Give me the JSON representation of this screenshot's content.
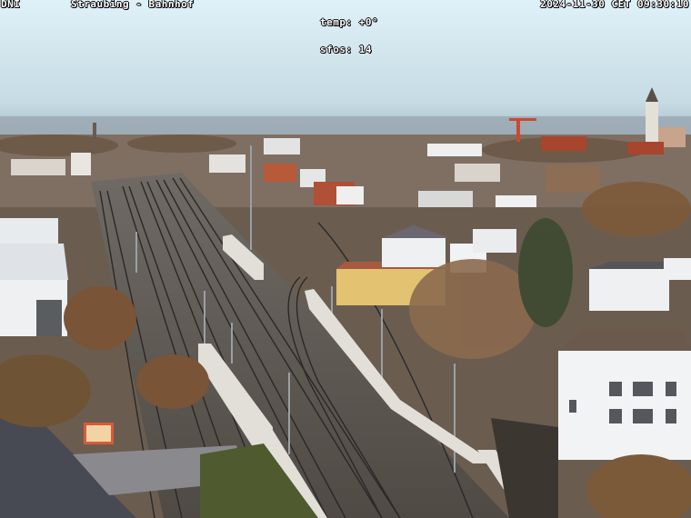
{
  "overlay": {
    "left_code": "DNI",
    "location": "Straubing - Bahnhof",
    "temp": "temp: +0°",
    "sfos": "sfos: 14",
    "datetime": "2024-11-30 CET 09:30:10"
  },
  "colors": {
    "sky_top": "#d9eef7",
    "sky_horizon": "#bcd0da",
    "haze": "#9aa9b4",
    "town": "#8a7462",
    "rail_bed": "#5a524c",
    "rail": "#2b2a2a",
    "wall": "#dedbd6",
    "roof_red": "#a5442e",
    "building_white": "#eef0f2",
    "trees": "#7a5a3c",
    "foreground_roof": "#4a4d55"
  }
}
